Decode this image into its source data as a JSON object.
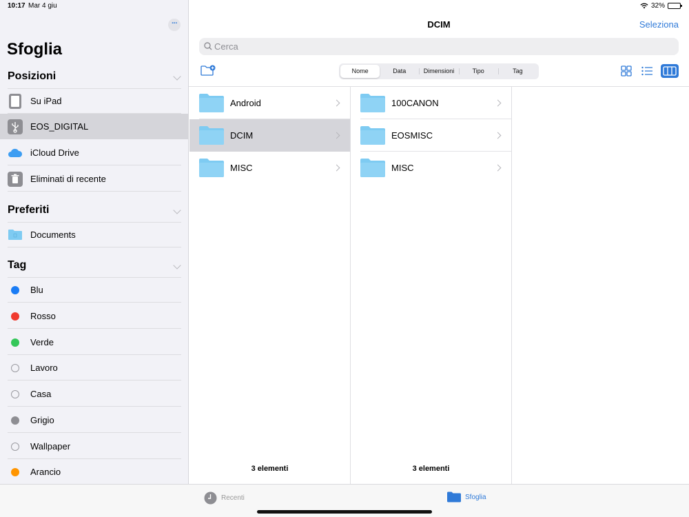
{
  "status": {
    "time": "10:17",
    "date": "Mar 4 giu",
    "battery": "32%",
    "battery_level": 0.32
  },
  "sidebar": {
    "title": "Sfoglia",
    "more": "···",
    "sections": {
      "locations": {
        "title": "Posizioni",
        "items": [
          "Su iPad",
          "EOS_DIGITAL",
          "iCloud Drive",
          "Eliminati di recente"
        ]
      },
      "favorites": {
        "title": "Preferiti",
        "items": [
          "Documents"
        ]
      },
      "tags": {
        "title": "Tag",
        "items": [
          {
            "label": "Blu",
            "color": "#1a7cf5"
          },
          {
            "label": "Rosso",
            "color": "#f03a2f"
          },
          {
            "label": "Verde",
            "color": "#34c759"
          },
          {
            "label": "Lavoro",
            "color": ""
          },
          {
            "label": "Casa",
            "color": ""
          },
          {
            "label": "Grigio",
            "color": "#8e8e93"
          },
          {
            "label": "Wallpaper",
            "color": ""
          },
          {
            "label": "Arancio",
            "color": "#ff9500"
          }
        ]
      }
    }
  },
  "main": {
    "title": "DCIM",
    "select_label": "Seleziona",
    "search_placeholder": "Cerca",
    "sort": [
      "Nome",
      "Data",
      "Dimensioni",
      "Tipo",
      "Tag"
    ],
    "columns": [
      {
        "items": [
          "Android",
          "DCIM",
          "MISC"
        ],
        "footer": "3 elementi"
      },
      {
        "items": [
          "100CANON",
          "EOSMISC",
          "MISC"
        ],
        "footer": "3 elementi"
      }
    ]
  },
  "tabbar": {
    "recenti": "Recenti",
    "sfoglia": "Sfoglia"
  },
  "colors": {
    "accent": "#2f7ad8",
    "folder": "#7ecbf2",
    "selection": "#d5d5da"
  }
}
